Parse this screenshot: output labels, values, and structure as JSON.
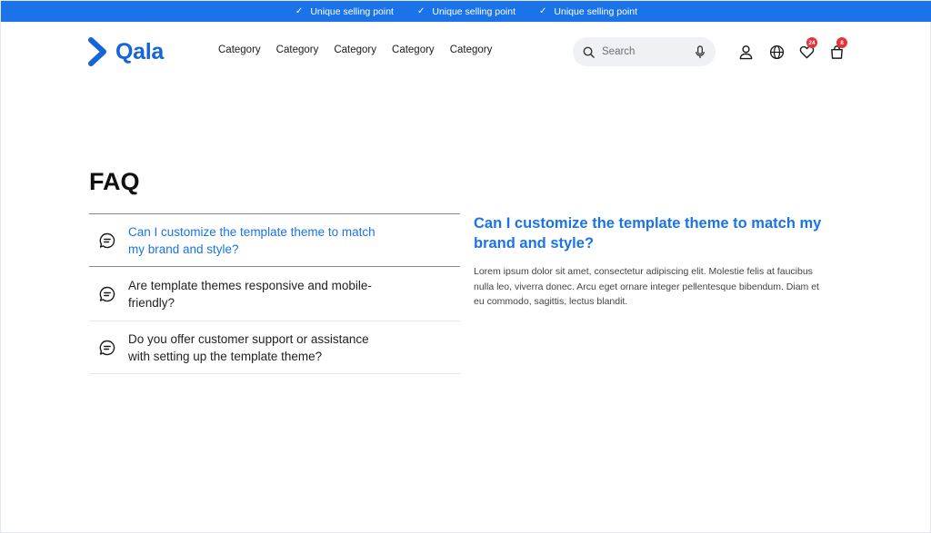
{
  "usp_bar": {
    "items": [
      "Unique selling point",
      "Unique selling point",
      "Unique selling point"
    ],
    "background": "#1a73e8"
  },
  "header": {
    "logo_text": "Qala",
    "nav": [
      "Category",
      "Category",
      "Category",
      "Category",
      "Category"
    ],
    "search": {
      "placeholder": "Search"
    },
    "icons": [
      "user-icon",
      "globe-icon",
      "heart-icon",
      "shopping-bag-icon"
    ],
    "wishlist_count": "24",
    "cart_count": "8"
  },
  "faq": {
    "title": "FAQ",
    "questions": [
      {
        "text": "Can I customize the template theme to match my brand and style?",
        "active": true
      },
      {
        "text": "Are template themes responsive and mobile-friendly?",
        "active": false
      },
      {
        "text": "Do you offer customer support or assistance with setting up the template theme?",
        "active": false
      }
    ],
    "answer": {
      "title": "Can I customize the template theme to match my brand and style?",
      "body": "Lorem ipsum dolor sit amet, consectetur adipiscing elit. Molestie felis at faucibus nulla leo, viverra donec. Arcu eget ornare integer pellentesque bibendum. Diam et eu commodo, sagittis, lectus blandit."
    },
    "accent_color": "#1a73e8"
  }
}
